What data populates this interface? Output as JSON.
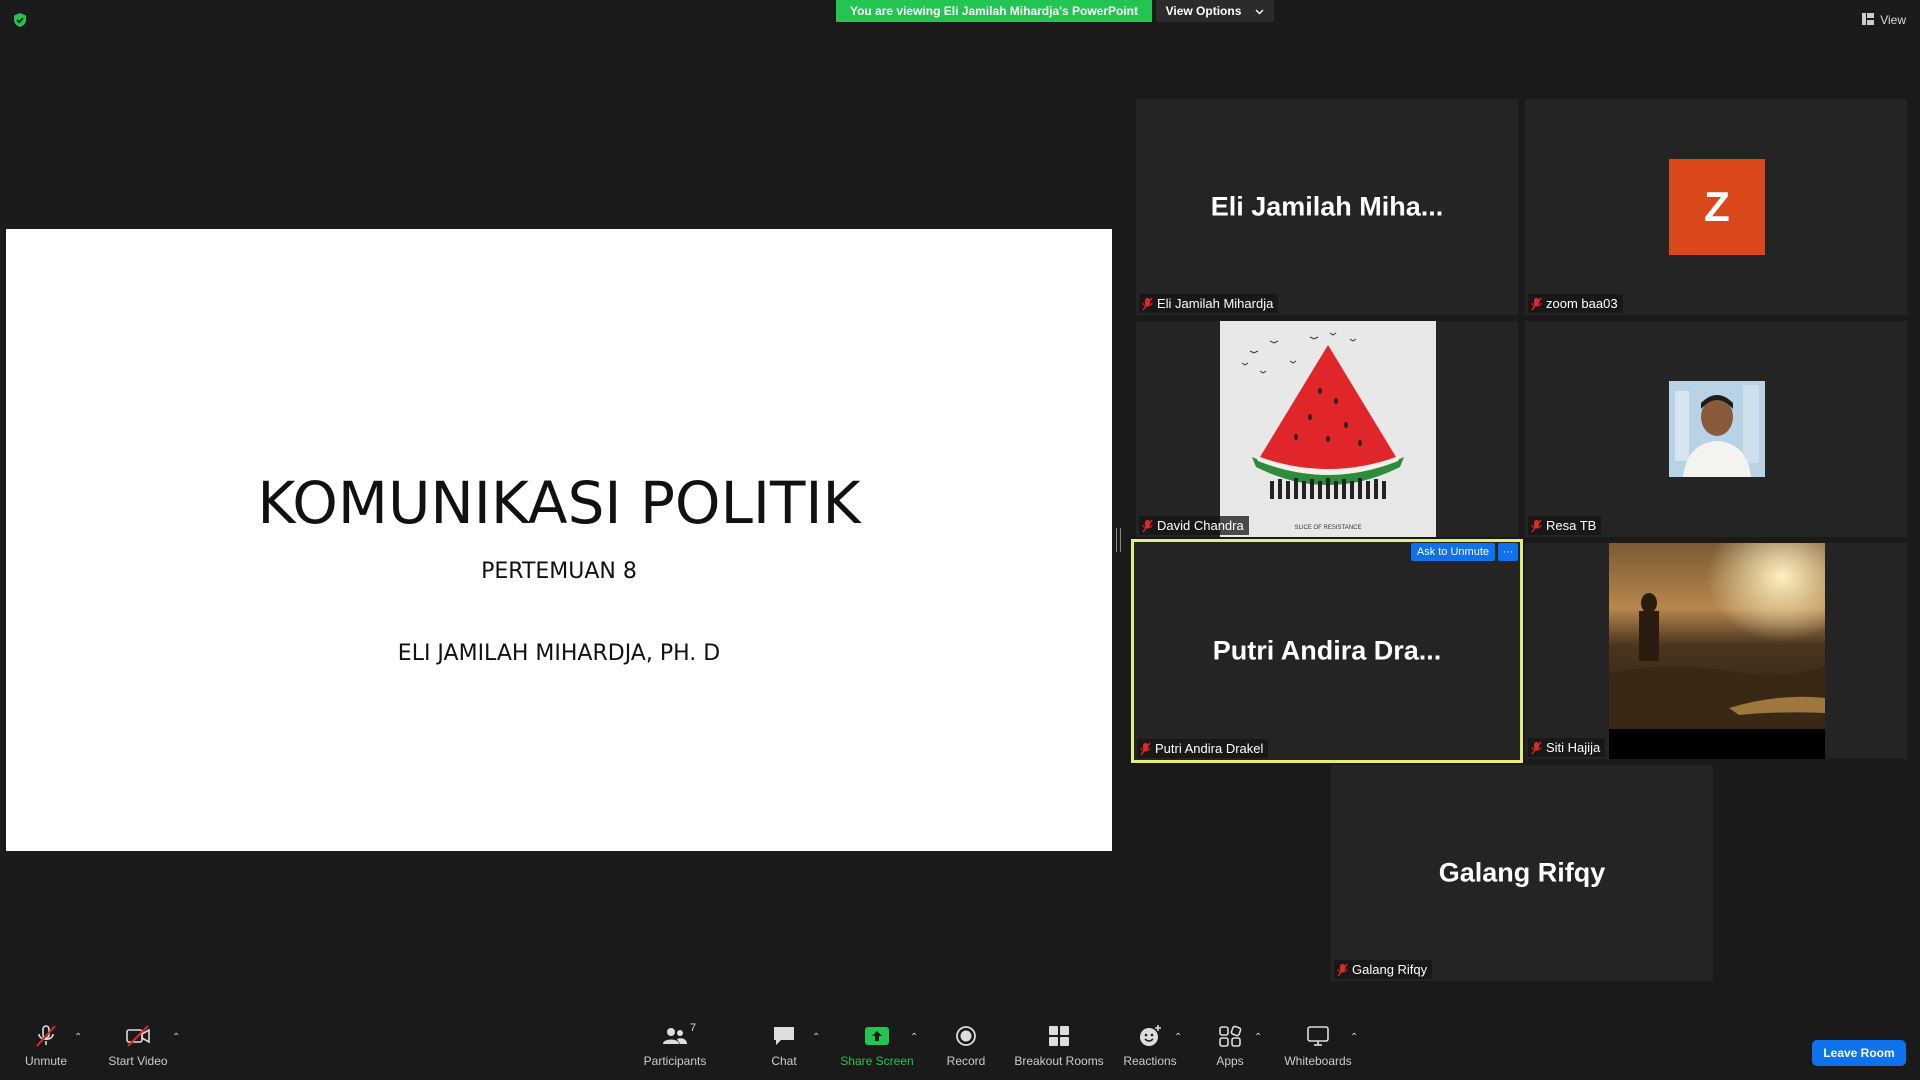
{
  "top_bar": {
    "viewing_banner": "You are viewing Eli Jamilah Mihardja's PowerPoint",
    "view_options": "View Options",
    "view_button": "View"
  },
  "slide": {
    "title": "KOMUNIKASI POLITIK",
    "subtitle": "PERTEMUAN 8",
    "author": "ELI JAMILAH MIHARDJA, PH. D"
  },
  "tiles": {
    "eli": {
      "big_name": "Eli Jamilah Miha...",
      "label": "Eli Jamilah Mihardja"
    },
    "zoom": {
      "avatar_letter": "Z",
      "label": "zoom baa03"
    },
    "david": {
      "label": "David Chandra",
      "image_caption": "SLICE OF RESISTANCE"
    },
    "resa": {
      "label": "Resa TB"
    },
    "putri": {
      "big_name": "Putri Andira Dra...",
      "label": "Putri Andira Drakel",
      "ask_unmute": "Ask to Unmute",
      "more": "···"
    },
    "siti": {
      "label": "Siti Hajija"
    },
    "galang": {
      "big_name": "Galang Rifqy",
      "label": "Galang Rifqy"
    }
  },
  "toolbar": {
    "unmute": "Unmute",
    "start_video": "Start Video",
    "participants": "Participants",
    "participants_count": "7",
    "chat": "Chat",
    "share_screen": "Share Screen",
    "record": "Record",
    "breakout_rooms": "Breakout Rooms",
    "reactions": "Reactions",
    "apps": "Apps",
    "whiteboards": "Whiteboards",
    "leave": "Leave Room"
  },
  "colors": {
    "background": "#1a1a1a",
    "tile": "#242424",
    "banner_green": "#23c552",
    "accent_blue": "#0e72ed",
    "active_speaker": "#e3ec7c",
    "muted_red": "#e02828",
    "avatar_orange": "#d9471b"
  }
}
